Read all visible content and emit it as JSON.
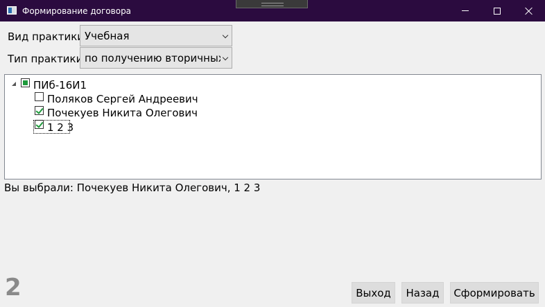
{
  "window": {
    "title": "Формирование договора"
  },
  "form": {
    "practice_kind": {
      "label": "Вид практики",
      "value": "Учебная"
    },
    "practice_type": {
      "label": "Тип практики",
      "value": "по получению вторичных"
    }
  },
  "tree": {
    "group": {
      "label": "ПИб-16И1",
      "state": "partial"
    },
    "students": [
      {
        "label": "Поляков Сергей Андреевич",
        "checked": false
      },
      {
        "label": "Почекуев Никита Олегович",
        "checked": true
      },
      {
        "label": "1 2 3",
        "checked": true
      }
    ]
  },
  "summary": {
    "text": "Вы выбрали: Почекуев Никита Олегович, 1 2 3"
  },
  "step": {
    "number": "2"
  },
  "buttons": {
    "exit": "Выход",
    "back": "Назад",
    "generate": "Сформировать"
  },
  "colors": {
    "titlebar": "#2b0b3f",
    "checkmark": "#1f9a3c"
  },
  "icons": {
    "app": "window-app-icon",
    "minimize": "minimize-icon",
    "maximize": "maximize-icon",
    "close": "close-icon",
    "dropdown": "chevron-down-icon",
    "expander": "tree-expanded-triangle-icon"
  }
}
